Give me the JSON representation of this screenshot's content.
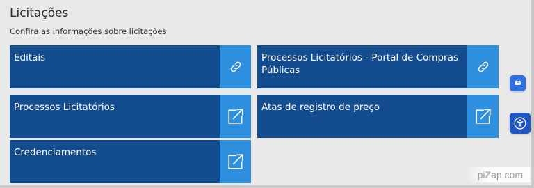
{
  "section": {
    "title": "Licitações",
    "subtitle": "Confira as informações sobre licitações"
  },
  "cards": [
    {
      "label": "Editais",
      "icon": "link-icon"
    },
    {
      "label": "Processos Licitatórios - Portal de Compras Públicas",
      "icon": "link-icon"
    },
    {
      "label": "Processos Licitatórios",
      "icon": "external-link-icon"
    },
    {
      "label": "Atas de registro de preço",
      "icon": "external-link-icon"
    },
    {
      "label": "Credenciamentos",
      "icon": "external-link-icon"
    }
  ],
  "side_widgets": {
    "vlibras_icon": "sign-language-hands-icon",
    "accessibility_icon": "accessibility-person-icon"
  },
  "watermark": "piZap.com",
  "colors": {
    "card_bg": "#134c8f",
    "icon_box_bg": "#2e8fde",
    "page_bg": "#e9e9e9",
    "widget_bg": "#2d6fe0"
  }
}
